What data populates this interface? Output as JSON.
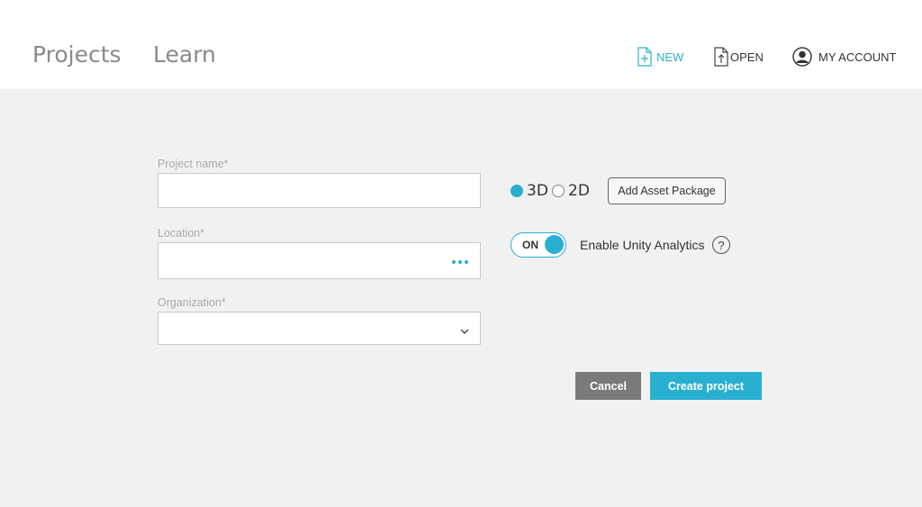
{
  "header": {
    "tabs": [
      {
        "label": "Projects"
      },
      {
        "label": "Learn"
      }
    ],
    "new_label": "NEW",
    "open_label": "OPEN",
    "account_label": "MY ACCOUNT"
  },
  "form": {
    "project_name": {
      "label": "Project name*",
      "value": ""
    },
    "location": {
      "label": "Location*",
      "value": ""
    },
    "organization": {
      "label": "Organization*",
      "selected": ""
    }
  },
  "options": {
    "modes": [
      {
        "label": "3D",
        "selected": true
      },
      {
        "label": "2D",
        "selected": false
      }
    ],
    "add_asset_label": "Add Asset Package",
    "toggle_state": "ON",
    "analytics_label": "Enable Unity Analytics",
    "help_symbol": "?"
  },
  "actions": {
    "cancel_label": "Cancel",
    "create_label": "Create project"
  },
  "colors": {
    "accent": "#29b0d0",
    "cancel_bg": "#7a7a7a",
    "background": "#f1f1f1"
  }
}
